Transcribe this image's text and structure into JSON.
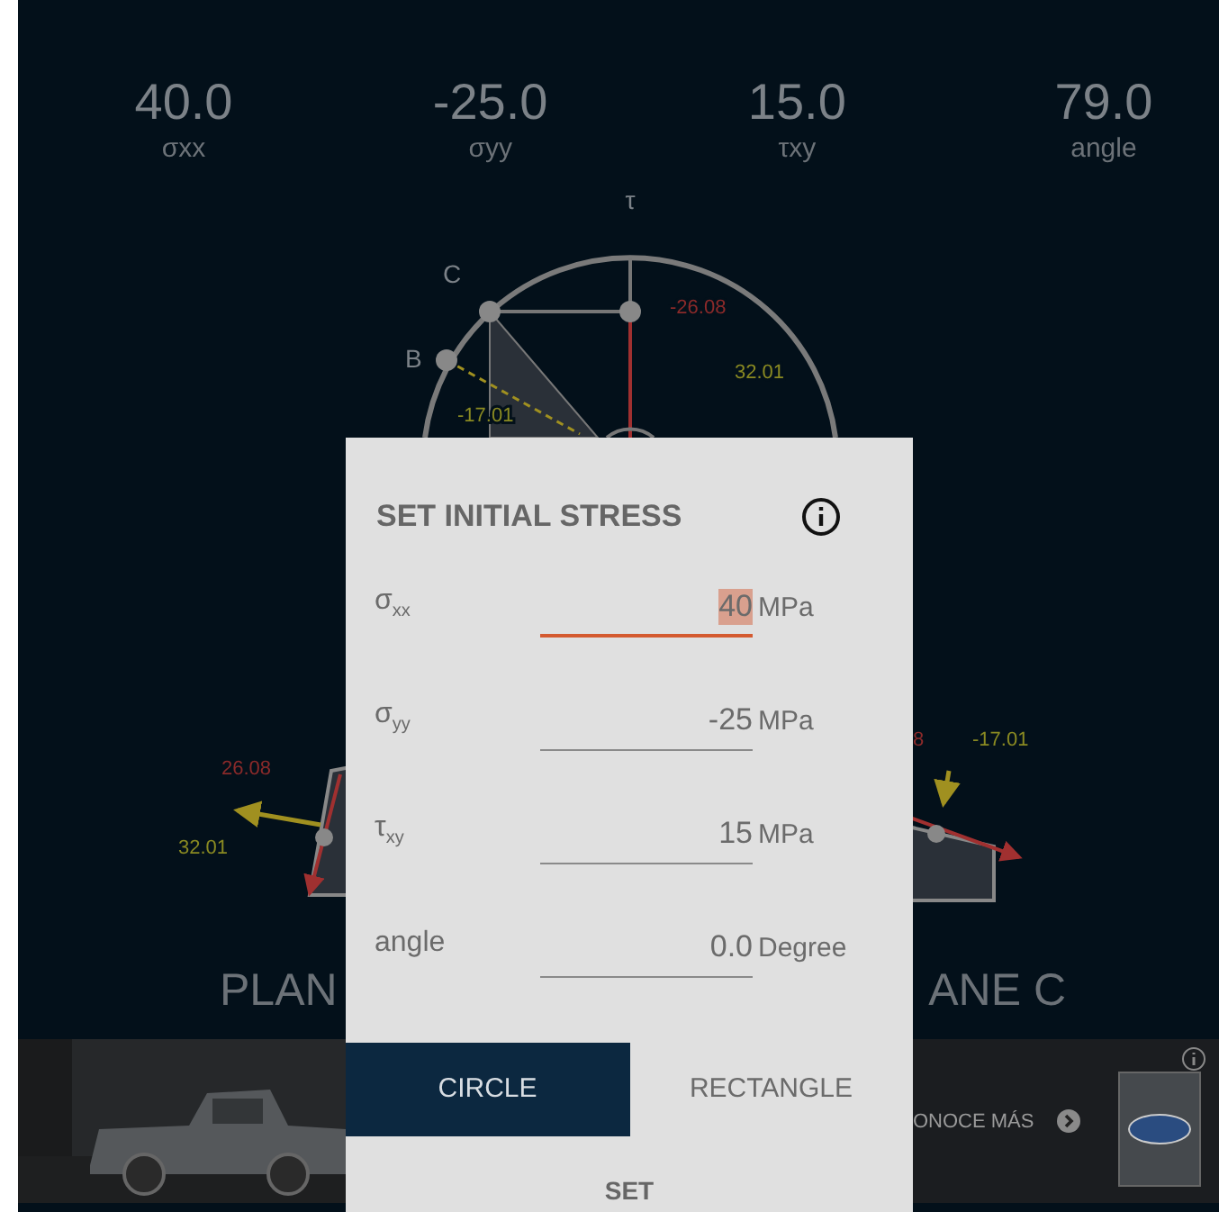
{
  "stats": [
    {
      "value": "40.0",
      "label": "σxx"
    },
    {
      "value": "-25.0",
      "label": "σyy"
    },
    {
      "value": "15.0",
      "label": "τxy"
    },
    {
      "value": "79.0",
      "label": "angle"
    }
  ],
  "diagram": {
    "axis_label": "τ",
    "points": [
      "C",
      "B"
    ],
    "values": [
      {
        "text": "-26.08",
        "kind": "shear"
      },
      {
        "text": "32.01",
        "kind": "normal"
      },
      {
        "text": "-17.01",
        "kind": "normal"
      }
    ]
  },
  "planes": [
    {
      "label": "PLAN",
      "values": [
        {
          "text": "26.08",
          "kind": "shear"
        },
        {
          "text": "32.01",
          "kind": "normal"
        }
      ]
    },
    {
      "label": "ANE C",
      "values": [
        {
          "text": "8",
          "kind": "shear"
        },
        {
          "text": "-17.01",
          "kind": "normal"
        }
      ]
    }
  ],
  "dialog": {
    "title": "SET INITIAL STRESS",
    "fields": [
      {
        "label": "σ$_{xx}$",
        "value": "40",
        "unit": "MPa",
        "focused": true
      },
      {
        "label": "σ$_{yy}$",
        "value": "-25",
        "unit": "MPa",
        "focused": false
      },
      {
        "label": "τ$_{xy}$",
        "value": "15",
        "unit": "MPa",
        "focused": false
      },
      {
        "label": "angle",
        "value": "0.0",
        "unit": "Degree",
        "focused": false
      }
    ],
    "modes": [
      {
        "label": "CIRCLE",
        "selected": true
      },
      {
        "label": "RECTANGLE",
        "selected": false
      }
    ],
    "action": "SET"
  },
  "ad": {
    "cta": "ONOCE MÁS"
  }
}
